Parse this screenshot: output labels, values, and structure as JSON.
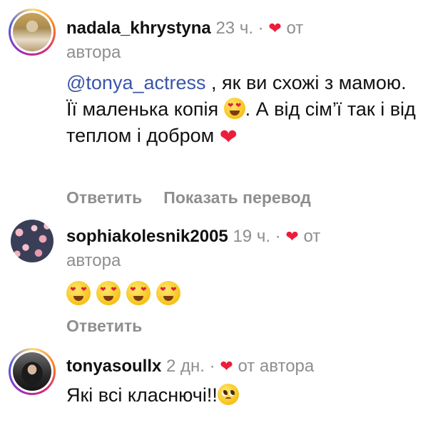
{
  "comments": [
    {
      "username": "nadala_khrystyna",
      "time": "23 ч.",
      "separator": "·",
      "liked_label_part1": "от",
      "liked_label_part2": "автора",
      "mention": "@tonya_actress",
      "text_part1": " , як ви схожі з мамою. Її маленька копія ",
      "text_part2": ". А від сім’ї так і від теплом і добром ",
      "reply_label": "Ответить",
      "translate_label": "Показать перевод",
      "emoji": [
        "heart-eyes-emoji",
        "red-heart-emoji"
      ]
    },
    {
      "username": "sophiakolesnik2005",
      "time": "19 ч.",
      "separator": "·",
      "liked_label_part1": "от",
      "liked_label_part2": "автора",
      "emoji_count": 4,
      "emoji": [
        "heart-eyes-emoji",
        "heart-eyes-emoji",
        "heart-eyes-emoji",
        "heart-eyes-emoji"
      ],
      "reply_label": "Ответить"
    },
    {
      "username": "tonyasoullx",
      "time": "2 дн.",
      "separator": "·",
      "liked_label": "от автора",
      "text": "Які всі класнючі!!",
      "emoji": [
        "pleading-face-emoji"
      ]
    }
  ],
  "colors": {
    "heart": "#ed1d3a",
    "meta": "#8e8e8e",
    "mention": "#3a55a8"
  }
}
